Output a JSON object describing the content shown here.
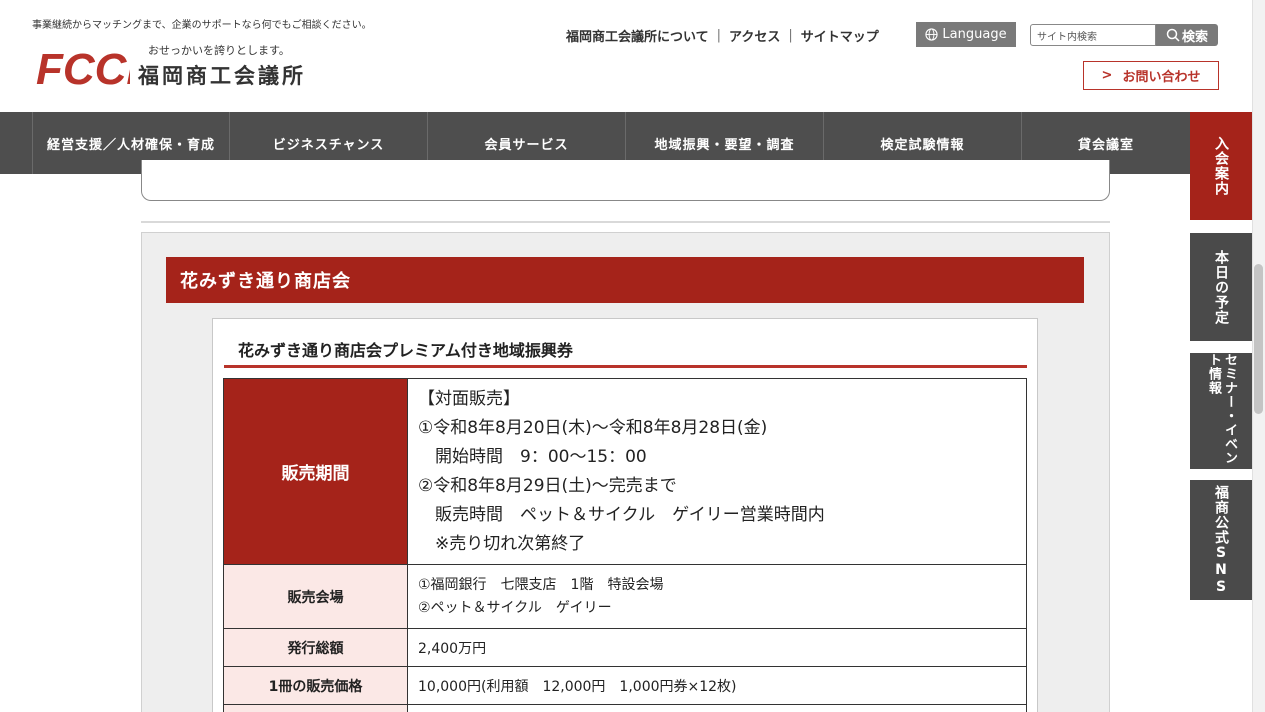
{
  "header": {
    "tagline": "事業継続からマッチングまで、企業のサポートなら何でもご相談ください。",
    "logo_text": "FCCI",
    "logo_sub": "おせっかいを誇りとします。",
    "org_name": "福岡商工会議所",
    "links": [
      "福岡商工会議所について",
      "アクセス",
      "サイトマップ"
    ],
    "language_label": "Language",
    "search_placeholder": "サイト内検索",
    "search_label": "検索",
    "contact_label": "お問い合わせ",
    "contact_arrow": ">"
  },
  "nav": {
    "items": [
      "経営支援／人材確保・育成",
      "ビジネスチャンス",
      "会員サービス",
      "地域振興・要望・調査",
      "検定試験情報",
      "貸会議室"
    ]
  },
  "side_tabs": {
    "join": "入会案内",
    "today": "本日の予定",
    "seminar": "セミナー・イベント情報",
    "sns": "福商公式SNS"
  },
  "section": {
    "title": "花みずき通り商店会",
    "card_title": "花みずき通り商店会プレミアム付き地域振興券",
    "rows": {
      "period": {
        "label": "販売期間",
        "lines": [
          "【対面販売】",
          "①令和8年8月20日(木)〜令和8年8月28日(金)",
          "　開始時間　9：00〜15：00",
          "②令和8年8月29日(土)〜完売まで",
          "　販売時間　ペット＆サイクル　ゲイリー営業時間内",
          "　※売り切れ次第終了"
        ]
      },
      "venue": {
        "label": "販売会場",
        "lines": [
          "①福岡銀行　七隈支店　1階　特設会場",
          "②ペット＆サイクル　ゲイリー"
        ]
      },
      "total": {
        "label": "発行総額",
        "value": "2,400万円"
      },
      "price": {
        "label": "1冊の販売価格",
        "value": "10,000円(利用額　12,000円　1,000円券×12枚)"
      }
    }
  },
  "colors": {
    "brand_red": "#a5231a",
    "nav_gray": "#4e4e4e",
    "label_pink": "#fbe8e6"
  }
}
